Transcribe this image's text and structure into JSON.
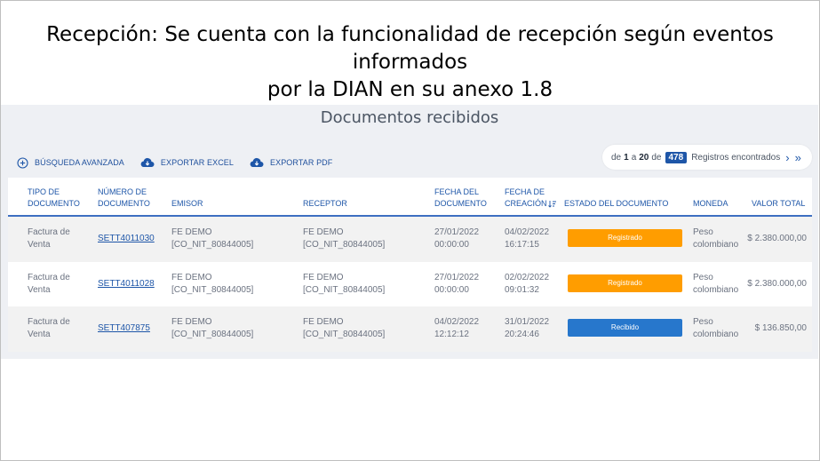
{
  "slide": {
    "title_line1": "Recepción: Se cuenta con la funcionalidad de recepción según eventos informados",
    "title_line2": "por la DIAN en su anexo 1.8"
  },
  "page": {
    "heading": "Documentos recibidos"
  },
  "toolbar": {
    "advanced_search": "BÚSQUEDA AVANZADA",
    "export_excel": "EXPORTAR EXCEL",
    "export_pdf": "EXPORTAR PDF"
  },
  "pager": {
    "prefix": "de",
    "from": "1",
    "sep": "a",
    "to": "20",
    "of": "de",
    "total": "478",
    "suffix": "Registros encontrados",
    "next": "›",
    "last": "»"
  },
  "table": {
    "headers": {
      "tipo_l1": "TIPO DE",
      "tipo_l2": "DOCUMENTO",
      "numero_l1": "NÚMERO DE",
      "numero_l2": "DOCUMENTO",
      "emisor": "EMISOR",
      "receptor": "RECEPTOR",
      "fecha_doc_l1": "FECHA DEL",
      "fecha_doc_l2": "DOCUMENTO",
      "fecha_cre_l1": "FECHA DE",
      "fecha_cre_l2": "CREACIÓN",
      "estado": "ESTADO DEL DOCUMENTO",
      "moneda": "MONEDA",
      "valor": "VALOR TOTAL"
    },
    "rows": [
      {
        "tipo_l1": "Factura de",
        "tipo_l2": "Venta",
        "numero": "SETT4011030",
        "emisor_l1": "FE DEMO",
        "emisor_l2": "[CO_NIT_80844005]",
        "receptor_l1": "FE DEMO",
        "receptor_l2": "[CO_NIT_80844005]",
        "fecha_doc_l1": "27/01/2022",
        "fecha_doc_l2": "00:00:00",
        "fecha_cre_l1": "04/02/2022",
        "fecha_cre_l2": "16:17:15",
        "estado": "Registrado",
        "moneda_l1": "Peso",
        "moneda_l2": "colombiano",
        "valor": "$ 2.380.000,00"
      },
      {
        "tipo_l1": "Factura de",
        "tipo_l2": "Venta",
        "numero": "SETT4011028",
        "emisor_l1": "FE DEMO",
        "emisor_l2": "[CO_NIT_80844005]",
        "receptor_l1": "FE DEMO",
        "receptor_l2": "[CO_NIT_80844005]",
        "fecha_doc_l1": "27/01/2022",
        "fecha_doc_l2": "00:00:00",
        "fecha_cre_l1": "02/02/2022",
        "fecha_cre_l2": "09:01:32",
        "estado": "Registrado",
        "moneda_l1": "Peso",
        "moneda_l2": "colombiano",
        "valor": "$ 2.380.000,00"
      },
      {
        "tipo_l1": "Factura de",
        "tipo_l2": "Venta",
        "numero": "SETT407875",
        "emisor_l1": "FE DEMO",
        "emisor_l2": "[CO_NIT_80844005]",
        "receptor_l1": "FE DEMO",
        "receptor_l2": "[CO_NIT_80844005]",
        "fecha_doc_l1": "04/02/2022",
        "fecha_doc_l2": "12:12:12",
        "fecha_cre_l1": "31/01/2022",
        "fecha_cre_l2": "20:24:46",
        "estado": "Recibido",
        "moneda_l1": "Peso",
        "moneda_l2": "colombiano",
        "valor": "$ 136.850,00"
      }
    ]
  },
  "colors": {
    "link": "#1e56a8",
    "registrado": "#ff9d00",
    "recibido": "#2777cc"
  },
  "icons": [
    "plus-circle-icon",
    "cloud-download-icon",
    "sort-icon",
    "chevron-right-icon",
    "double-chevron-right-icon"
  ]
}
